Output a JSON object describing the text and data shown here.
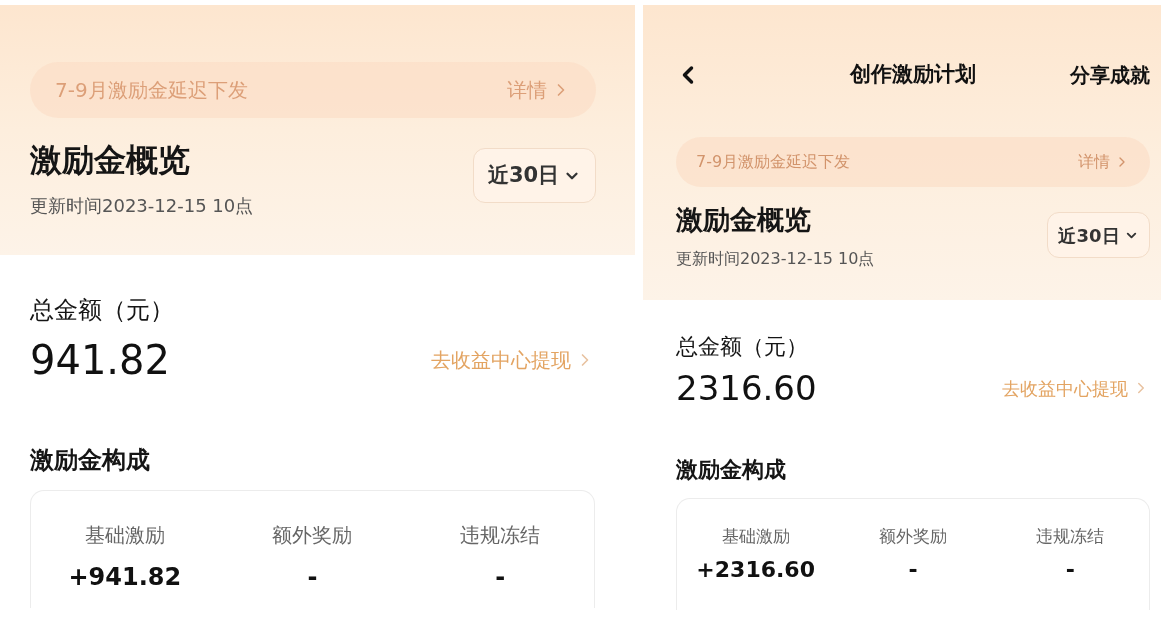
{
  "screens": [
    {
      "notice": {
        "text": "7-9月激励金延迟下发",
        "link": "详情"
      },
      "title": "激励金概览",
      "updated": "更新时间2023-12-15 10点",
      "range": "近30日",
      "total": {
        "label": "总金额（元）",
        "amount": "941.82",
        "link": "去收益中心提现"
      },
      "breakdown": {
        "title": "激励金构成",
        "items": [
          {
            "label": "基础激励",
            "value": "+941.82"
          },
          {
            "label": "额外奖励",
            "value": "-"
          },
          {
            "label": "违规冻结",
            "value": "-"
          }
        ]
      }
    },
    {
      "nav": {
        "title": "创作激励计划",
        "action": "分享成就"
      },
      "notice": {
        "text": "7-9月激励金延迟下发",
        "link": "详情"
      },
      "title": "激励金概览",
      "updated": "更新时间2023-12-15 10点",
      "range": "近30日",
      "total": {
        "label": "总金额（元）",
        "amount": "2316.60",
        "link": "去收益中心提现"
      },
      "breakdown": {
        "title": "激励金构成",
        "items": [
          {
            "label": "基础激励",
            "value": "+2316.60"
          },
          {
            "label": "额外奖励",
            "value": "-"
          },
          {
            "label": "违规冻结",
            "value": "-"
          }
        ]
      }
    }
  ]
}
